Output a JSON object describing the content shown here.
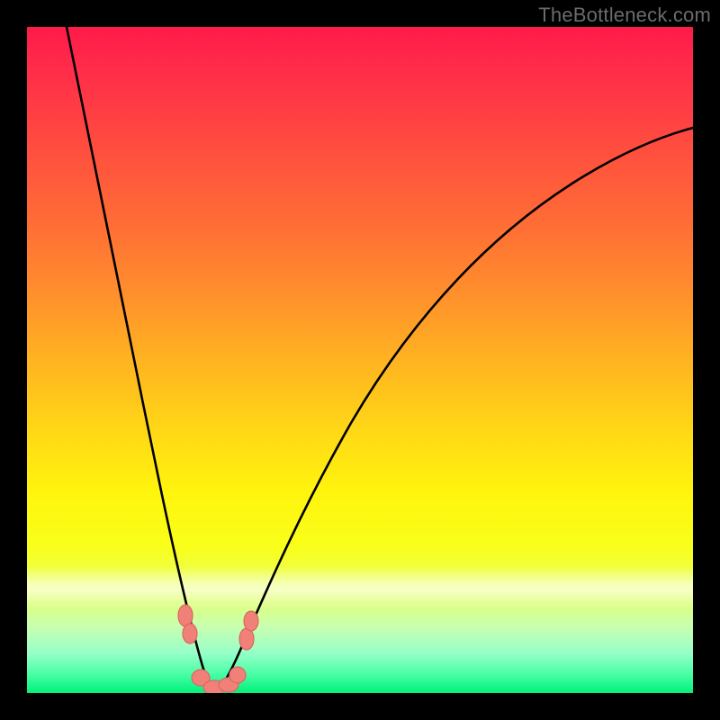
{
  "watermark": "TheBottleneck.com",
  "chart_data": {
    "type": "line",
    "title": "",
    "xlabel": "",
    "ylabel": "",
    "xlim": [
      0,
      100
    ],
    "ylim": [
      0,
      100
    ],
    "grid": false,
    "note": "V-shaped curve with minimum near x≈27, y≈0. Values estimated from plot; no axis ticks or labels rendered.",
    "series": [
      {
        "name": "left-branch",
        "x": [
          6,
          8,
          10,
          12,
          14,
          16,
          18,
          20,
          22,
          24,
          25,
          26,
          27,
          28
        ],
        "y": [
          100,
          93,
          84,
          75,
          66,
          56,
          46,
          36,
          26,
          15,
          9,
          4,
          1,
          0
        ]
      },
      {
        "name": "right-branch",
        "x": [
          28,
          29,
          30,
          32,
          34,
          37,
          40,
          44,
          48,
          53,
          58,
          64,
          70,
          77,
          84,
          92,
          100
        ],
        "y": [
          0,
          1,
          3,
          7,
          12,
          20,
          28,
          37,
          45,
          53,
          60,
          66,
          71,
          76,
          80,
          83,
          85
        ]
      }
    ],
    "markers": {
      "note": "Pink bead-like markers near trough of curve",
      "points": [
        {
          "x": 23.5,
          "y": 12
        },
        {
          "x": 24.2,
          "y": 9
        },
        {
          "x": 25.8,
          "y": 2.5
        },
        {
          "x": 27.5,
          "y": 0.5
        },
        {
          "x": 29.2,
          "y": 1.0
        },
        {
          "x": 30.8,
          "y": 2.8
        },
        {
          "x": 32.4,
          "y": 8.5
        },
        {
          "x": 33.0,
          "y": 11
        }
      ]
    }
  }
}
